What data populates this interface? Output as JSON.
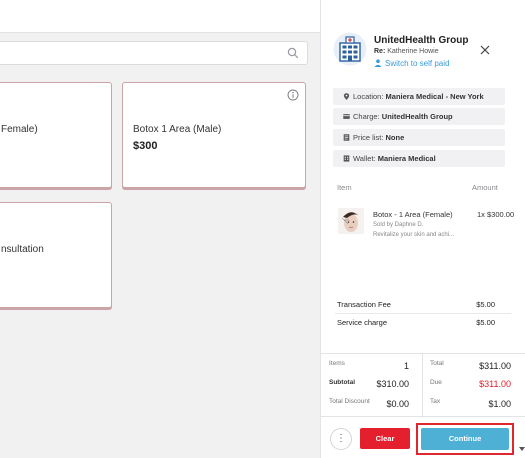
{
  "search": {
    "value": "",
    "placeholder": ""
  },
  "services": [
    {
      "name": "Female)",
      "price": ""
    },
    {
      "name": "Botox 1 Area (Male)",
      "price": "$300"
    },
    {
      "name": "nsultation",
      "price": ""
    }
  ],
  "payer": {
    "name": "UnitedHealth Group",
    "re_label": "Re:",
    "re_name": "Katherine Howie",
    "switch_label": "Switch to self paid"
  },
  "meta": {
    "location_label": "Location:",
    "location_value": "Maniera Medical - New York",
    "charge_label": "Charge:",
    "charge_value": "UnitedHealth Group",
    "pricelist_label": "Price list:",
    "pricelist_value": "None",
    "wallet_label": "Wallet:",
    "wallet_value": "Maniera Medical"
  },
  "cart": {
    "col_item": "Item",
    "col_amount": "Amount",
    "items": [
      {
        "name": "Botox - 1 Area (Female)",
        "qty_amount": "1x $300.00",
        "sold_by": "Sold by Daphne D.",
        "description": "Revitalize your skin and achi..."
      }
    ]
  },
  "fees": [
    {
      "label": "Transaction Fee",
      "value": "$5.00"
    },
    {
      "label": "Service charge",
      "value": "$5.00"
    }
  ],
  "totals": {
    "items_label": "Items",
    "items_value": "1",
    "subtotal_label": "Subtotal",
    "subtotal_value": "$310.00",
    "discount_label": "Total Discount",
    "discount_value": "$0.00",
    "total_label": "Total",
    "total_value": "$311.00",
    "due_label": "Due",
    "due_value": "$311.00",
    "tax_label": "Tax",
    "tax_value": "$1.00"
  },
  "actions": {
    "more_label": "⋮",
    "clear_label": "Clear",
    "continue_label": "Continue"
  },
  "colors": {
    "accent": "#4fb0d6",
    "danger": "#e4202e",
    "link": "#3a9ad9",
    "card_border": "#c9a5a8"
  }
}
